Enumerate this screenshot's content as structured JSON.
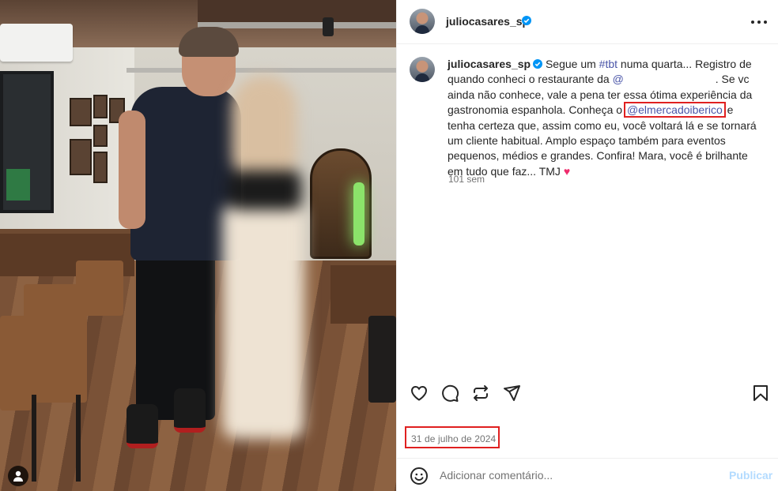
{
  "post": {
    "username": "juliocasares_sp",
    "verified_icon": "verified-badge-icon",
    "more_icon": "more-options-icon"
  },
  "caption": {
    "username": "juliocasares_sp",
    "part1": " Segue um ",
    "hashtag": "#tbt",
    "part2": " numa quarta... Registro de quando conheci o restaurante da ",
    "mention_hidden": "@",
    "part3": " . Se vc ainda não conhece, vale a pena ter essa ótima experiência da gastronomia espanhola. Conheça o ",
    "mention": "@elmercadoiberico",
    "part4": " e tenha certeza que, assim como eu, você voltará lá e se tornará um cliente habitual. Amplo espaço também para eventos pequenos, médios e grandes. Confira! Mara, você é brilhante em tudo que faz... TMJ ",
    "heart": "♥",
    "age": "101 sem"
  },
  "actions": {
    "like_icon": "heart-icon",
    "comment_icon": "comment-icon",
    "repost_icon": "repost-icon",
    "share_icon": "share-icon",
    "save_icon": "bookmark-icon"
  },
  "date": "31 de julho de 2024",
  "comment": {
    "emoji_icon": "emoji-icon",
    "placeholder": "Adicionar comentário...",
    "publish": "Publicar"
  },
  "colors": {
    "link": "#4a55a8",
    "verified": "#0095f6",
    "highlight_box": "#e02020",
    "publish_disabled": "#b3dbff"
  }
}
